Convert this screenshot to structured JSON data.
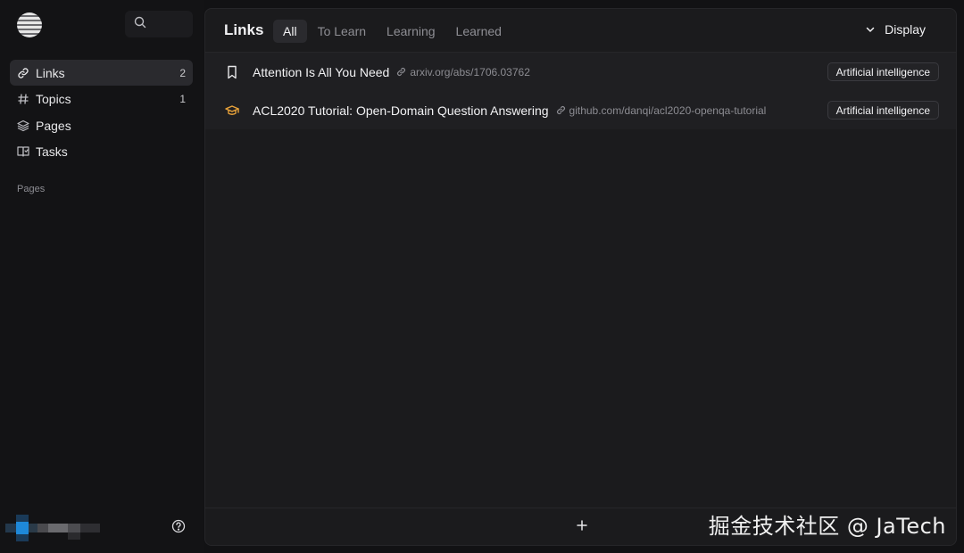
{
  "sidebar": {
    "logo": "stripe-globe-logo",
    "search_icon": "search-icon",
    "items": [
      {
        "label": "Links",
        "count": "2",
        "icon": "link-icon",
        "active": true
      },
      {
        "label": "Topics",
        "count": "1",
        "icon": "hash-icon",
        "active": false
      },
      {
        "label": "Pages",
        "count": "",
        "icon": "layers-icon",
        "active": false
      },
      {
        "label": "Tasks",
        "count": "",
        "icon": "book-check-icon",
        "active": false
      }
    ],
    "section_label": "Pages",
    "help_icon": "help-circle-icon"
  },
  "header": {
    "title": "Links",
    "tabs": [
      {
        "label": "All",
        "active": true
      },
      {
        "label": "To Learn",
        "active": false
      },
      {
        "label": "Learning",
        "active": false
      },
      {
        "label": "Learned",
        "active": false
      }
    ],
    "display_label": "Display"
  },
  "links": [
    {
      "title": "Attention Is All You Need",
      "url": "arxiv.org/abs/1706.03762",
      "tag": "Artificial intelligence",
      "status_icon": "bookmark-icon"
    },
    {
      "title": "ACL2020 Tutorial: Open-Domain Question Answering",
      "url": "github.com/danqi/acl2020-openqa-tutorial",
      "tag": "Artificial intelligence",
      "status_icon": "graduation-cap-icon"
    }
  ],
  "footer": {
    "add_icon": "plus-icon"
  },
  "watermark": "掘金技术社区 @ JaTech",
  "colors": {
    "background": "#121214",
    "panel": "#1b1b1d",
    "active_item": "#2a2a2e",
    "learning_icon": "#e8a23a"
  }
}
